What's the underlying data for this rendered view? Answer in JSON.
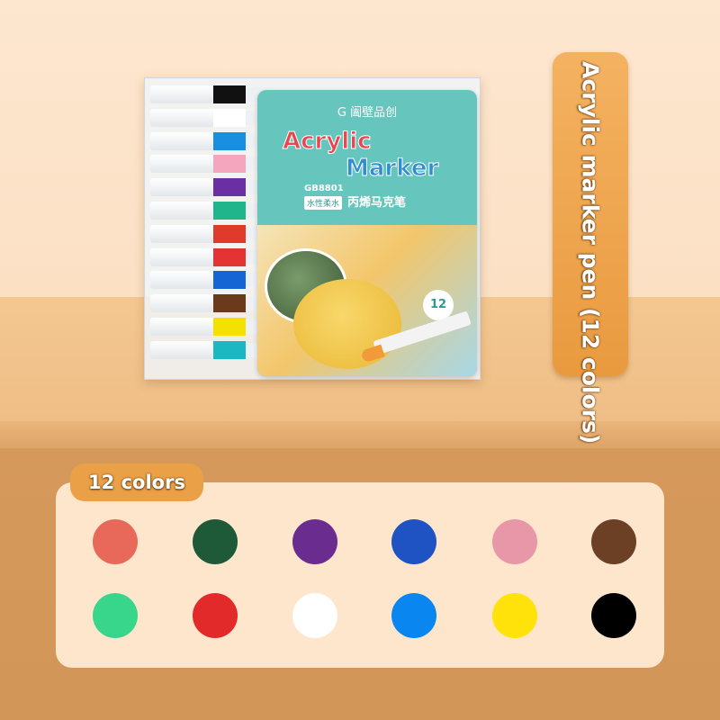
{
  "product": {
    "side_label": "Acrylic marker pen (12 colors)",
    "colors_label": "12 colors",
    "card": {
      "brand": "G 阖壁品创",
      "title_line1": "Acrylic",
      "title_line2": "Marker",
      "code": "GB8801",
      "tag": "水性柔水",
      "cn_name": "丙烯马克笔",
      "count": "12"
    }
  },
  "pens": [
    "#111111",
    "#ffffff",
    "#1a8fe0",
    "#f3a6bd",
    "#6a2fa3",
    "#20b58b",
    "#e03a2a",
    "#e33433",
    "#1565d4",
    "#6b3a1d",
    "#f5e100",
    "#1bb7c2"
  ],
  "swatches": [
    {
      "name": "coral",
      "color": "#e8685a"
    },
    {
      "name": "dark-green",
      "color": "#1e5a38"
    },
    {
      "name": "purple",
      "color": "#6a2d8f"
    },
    {
      "name": "blue",
      "color": "#1f53c4"
    },
    {
      "name": "pink",
      "color": "#e797a8"
    },
    {
      "name": "brown",
      "color": "#6b4025"
    },
    {
      "name": "light-green",
      "color": "#38d68a"
    },
    {
      "name": "red",
      "color": "#e22a2a"
    },
    {
      "name": "white",
      "color": "#ffffff"
    },
    {
      "name": "sky-blue",
      "color": "#0a86f0"
    },
    {
      "name": "yellow",
      "color": "#ffe20a"
    },
    {
      "name": "black",
      "color": "#000000"
    }
  ]
}
